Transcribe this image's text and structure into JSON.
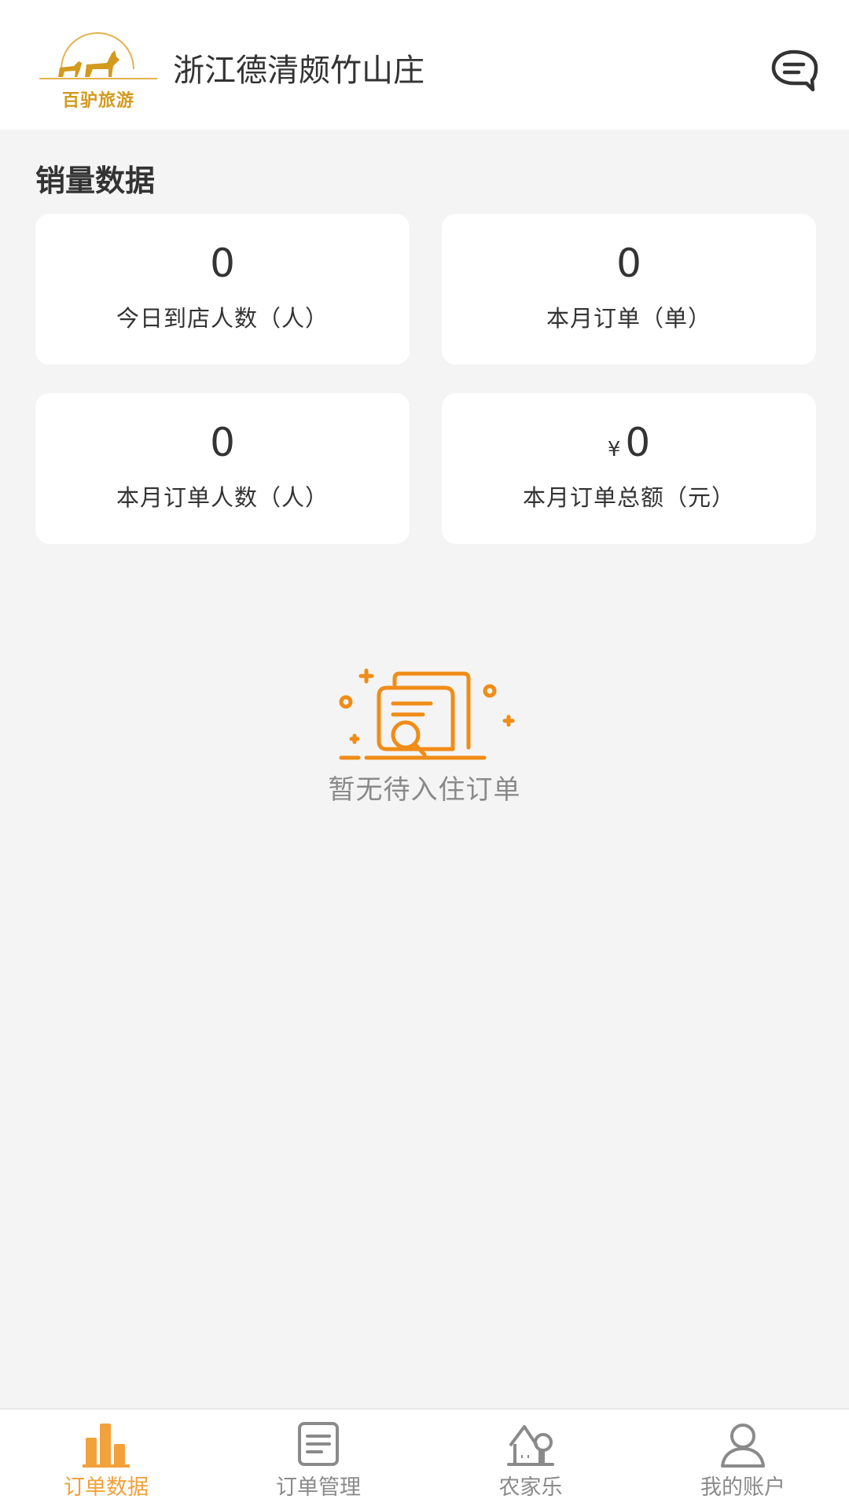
{
  "header": {
    "logo_text": "百驴旅游",
    "title": "浙江德清颇竹山庄"
  },
  "section_title": "销量数据",
  "stats": [
    {
      "value": "0",
      "label": "今日到店人数（人）"
    },
    {
      "value": "0",
      "label": "本月订单（单）"
    },
    {
      "value": "0",
      "label": "本月订单人数（人）"
    },
    {
      "value": "0",
      "currency": "¥",
      "label": "本月订单总额（元）"
    }
  ],
  "empty_state": {
    "text": "暂无待入住订单",
    "icon": "document-search-icon"
  },
  "tabs": [
    {
      "label": "订单数据",
      "icon": "bar-chart-icon",
      "active": true
    },
    {
      "label": "订单管理",
      "icon": "document-list-icon",
      "active": false
    },
    {
      "label": "农家乐",
      "icon": "house-tree-icon",
      "active": false
    },
    {
      "label": "我的账户",
      "icon": "user-icon",
      "active": false
    }
  ],
  "colors": {
    "accent": "#f2a13b",
    "brand_gold": "#d39a1e",
    "icon_orange": "#f08c17",
    "inactive": "#8a8a8a",
    "background": "#f4f4f4"
  }
}
